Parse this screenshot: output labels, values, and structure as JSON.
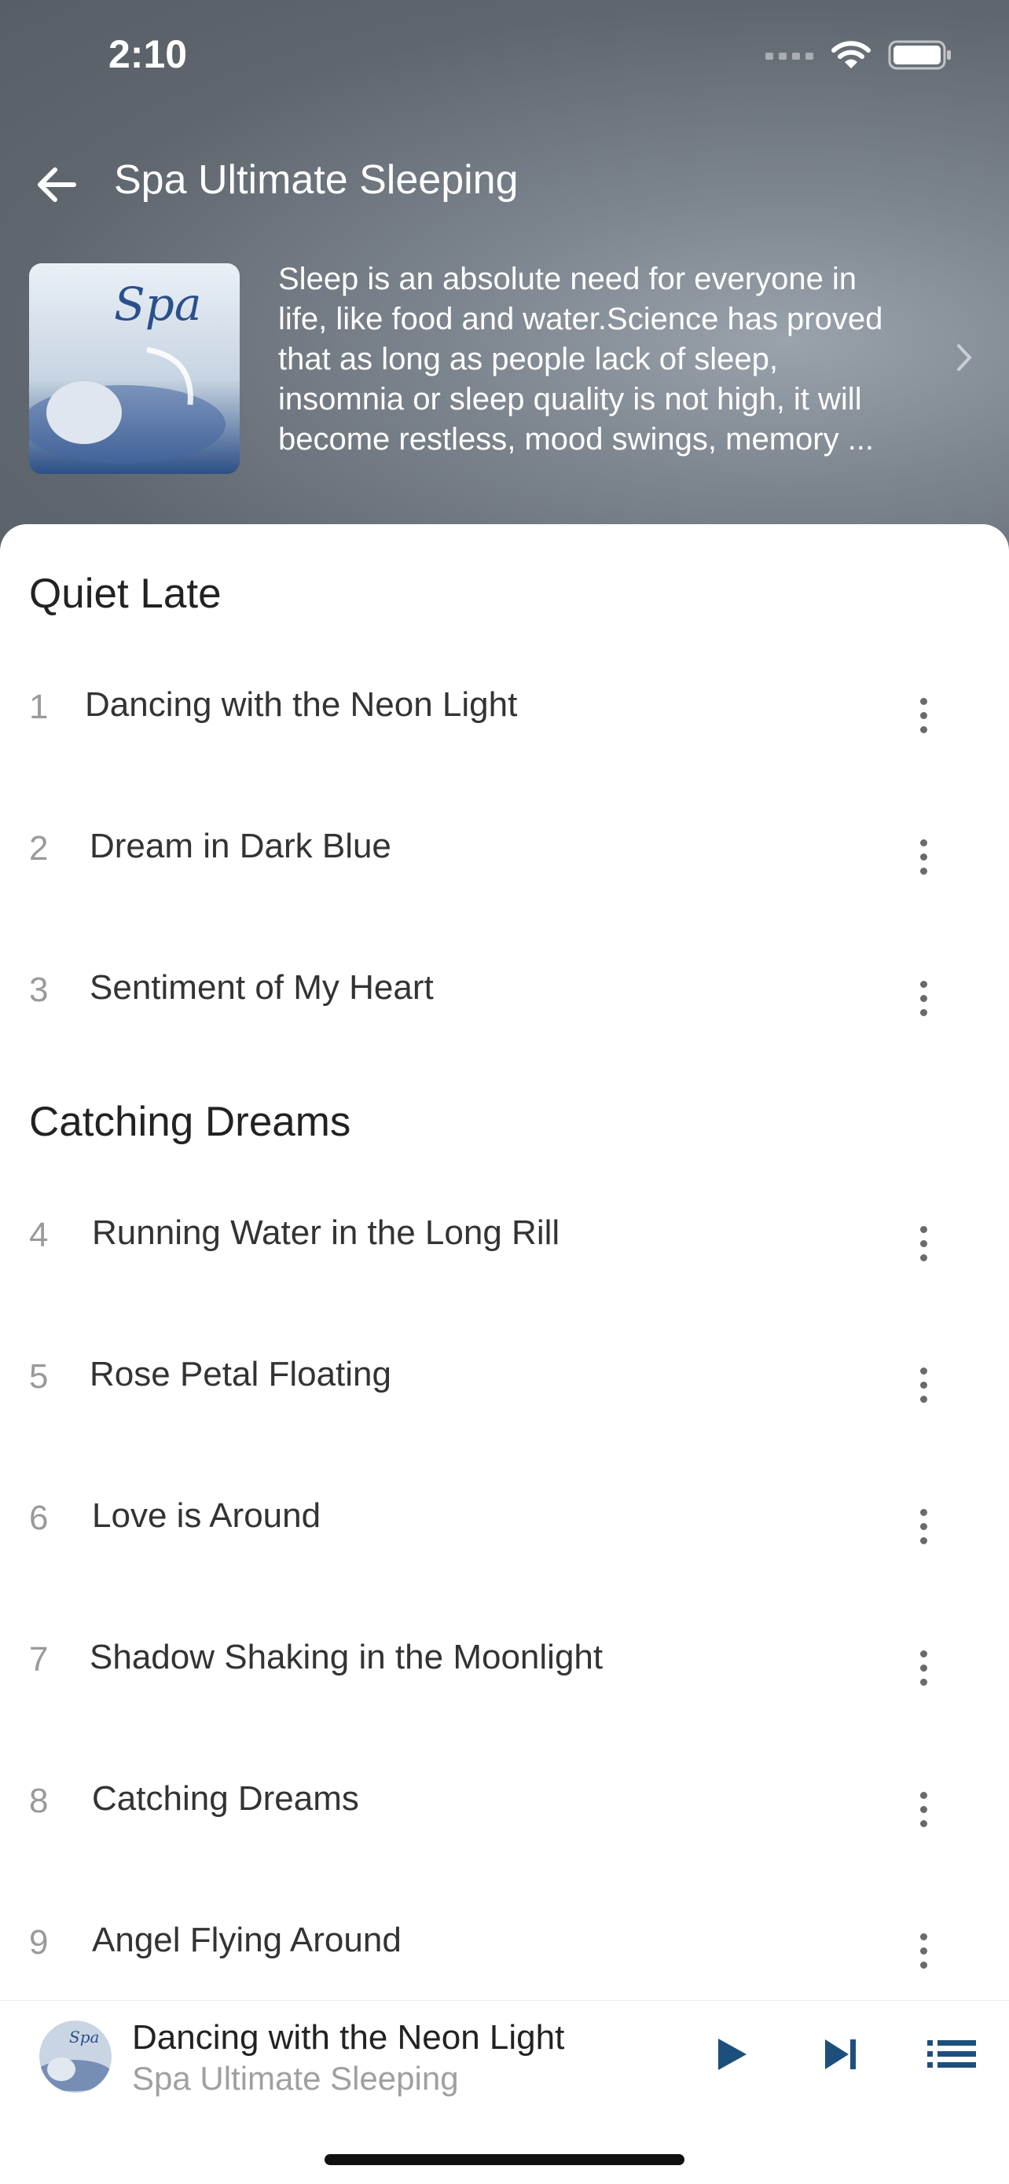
{
  "status_bar": {
    "time": "2:10"
  },
  "header": {
    "title": "Spa Ultimate Sleeping"
  },
  "album": {
    "cover_text": "Spa",
    "description": "Sleep is an absolute need for everyone in\nlife, like food and water.Science has proved\nthat as long as people lack of sleep,\ninsomnia or sleep quality is not high, it will\nbecome restless, mood swings, memory ..."
  },
  "sections": [
    {
      "title": "Quiet Late",
      "tracks": [
        {
          "number": "1",
          "title": "Dancing with the Neon Light"
        },
        {
          "number": "2",
          "title": "Dream in Dark Blue"
        },
        {
          "number": "3",
          "title": "Sentiment of My Heart"
        }
      ]
    },
    {
      "title": "Catching Dreams",
      "tracks": [
        {
          "number": "4",
          "title": "Running Water in the Long Rill"
        },
        {
          "number": "5",
          "title": "Rose Petal Floating"
        },
        {
          "number": "6",
          "title": "Love is Around"
        },
        {
          "number": "7",
          "title": "Shadow Shaking in the Moonlight"
        },
        {
          "number": "8",
          "title": "Catching Dreams"
        },
        {
          "number": "9",
          "title": "Angel Flying Around"
        }
      ]
    }
  ],
  "player": {
    "title": "Dancing with the Neon Light",
    "artist": "Spa Ultimate Sleeping"
  },
  "colors": {
    "accent": "#1d4f7c",
    "header_bg": "#5f666e"
  },
  "icons": [
    "back-arrow-icon",
    "chevron-right-icon",
    "more-vertical-icon",
    "play-icon",
    "skip-next-icon",
    "queue-list-icon",
    "wifi-icon",
    "battery-icon",
    "signal-icon"
  ]
}
